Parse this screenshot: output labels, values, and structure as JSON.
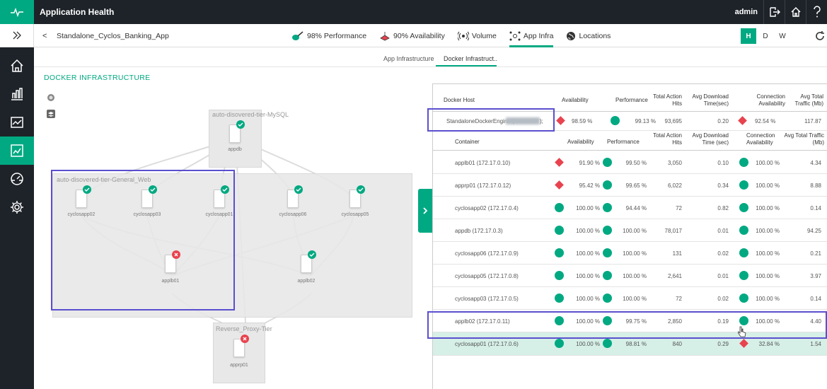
{
  "header": {
    "title": "Application Health",
    "user": "admin"
  },
  "toolbar": {
    "back": "<",
    "app_name": "Standalone_Cyclos_Banking_App",
    "tabs": [
      {
        "label": "98% Performance",
        "icon": "performance-icon"
      },
      {
        "label": "90% Availability",
        "icon": "availability-icon"
      },
      {
        "label": "Volume",
        "icon": "volume-icon"
      },
      {
        "label": "App Infra",
        "icon": "app-infra-icon",
        "active": true
      },
      {
        "label": "Locations",
        "icon": "globe-icon"
      }
    ],
    "time_buttons": [
      "H",
      "D",
      "W"
    ]
  },
  "subtabs": [
    "App Infrastructure",
    "Docker Infrastruct.."
  ],
  "section_title": "DOCKER INFRASTRUCTURE",
  "topology": {
    "tiers": [
      {
        "label": "auto-disovered-tier-MySQL"
      },
      {
        "label": "auto-disovered-tier-General_Web"
      },
      {
        "label": "Reverse_Proxy-Tier"
      }
    ],
    "nodes": [
      {
        "label": "appdb",
        "status": "ok"
      },
      {
        "label": "cyclosapp02",
        "status": "ok"
      },
      {
        "label": "cyclosapp03",
        "status": "ok"
      },
      {
        "label": "cyclosapp01",
        "status": "ok"
      },
      {
        "label": "cyclosapp06",
        "status": "ok"
      },
      {
        "label": "cyclosapp05",
        "status": "ok"
      },
      {
        "label": "applb01",
        "status": "bad"
      },
      {
        "label": "applb02",
        "status": "ok"
      },
      {
        "label": "apprp01",
        "status": "bad"
      }
    ]
  },
  "host_table": {
    "headers": [
      "Docker Host",
      "Availability",
      "Performance",
      "Total Action Hits",
      "Avg Download Time(sec)",
      "Connection Availability",
      "Avg Total Traffic (Mb)"
    ],
    "row": {
      "host": "StandaloneDockerEngine (",
      "availability": "98.59 %",
      "performance": "99.13 %",
      "hits": "93,695",
      "download": "0.20",
      "connection": "92.54 %",
      "traffic": "117.87"
    }
  },
  "container_table": {
    "headers": [
      "Container",
      "Availability",
      "Performance",
      "Total Action Hits",
      "Avg Download Time (sec)",
      "Connection Availability",
      "Avg Total Traffic (Mb)"
    ],
    "rows": [
      {
        "name": "applb01 (172.17.0.10)",
        "avail": "91.90 %",
        "avail_status": "bad",
        "perf": "99.50 %",
        "hits": "3,050",
        "dl": "0.10",
        "conn": "100.00 %",
        "conn_status": "ok",
        "traffic": "4.34"
      },
      {
        "name": "apprp01 (172.17.0.12)",
        "avail": "95.42 %",
        "avail_status": "bad",
        "perf": "99.65 %",
        "hits": "6,022",
        "dl": "0.34",
        "conn": "100.00 %",
        "conn_status": "ok",
        "traffic": "8.88"
      },
      {
        "name": "cyclosapp02 (172.17.0.4)",
        "avail": "100.00 %",
        "avail_status": "ok",
        "perf": "94.44 %",
        "hits": "72",
        "dl": "0.82",
        "conn": "100.00 %",
        "conn_status": "ok",
        "traffic": "0.14"
      },
      {
        "name": "appdb (172.17.0.3)",
        "avail": "100.00 %",
        "avail_status": "ok",
        "perf": "100.00 %",
        "hits": "78,017",
        "dl": "0.01",
        "conn": "100.00 %",
        "conn_status": "ok",
        "traffic": "94.25"
      },
      {
        "name": "cyclosapp06 (172.17.0.9)",
        "avail": "100.00 %",
        "avail_status": "ok",
        "perf": "100.00 %",
        "hits": "131",
        "dl": "0.02",
        "conn": "100.00 %",
        "conn_status": "ok",
        "traffic": "0.21"
      },
      {
        "name": "cyclosapp05 (172.17.0.8)",
        "avail": "100.00 %",
        "avail_status": "ok",
        "perf": "100.00 %",
        "hits": "2,641",
        "dl": "0.01",
        "conn": "100.00 %",
        "conn_status": "ok",
        "traffic": "3.97"
      },
      {
        "name": "cyclosapp03 (172.17.0.5)",
        "avail": "100.00 %",
        "avail_status": "ok",
        "perf": "100.00 %",
        "hits": "72",
        "dl": "0.02",
        "conn": "100.00 %",
        "conn_status": "ok",
        "traffic": "0.14"
      },
      {
        "name": "applb02 (172.17.0.11)",
        "avail": "100.00 %",
        "avail_status": "ok",
        "perf": "99.75 %",
        "hits": "2,850",
        "dl": "0.19",
        "conn": "100.00 %",
        "conn_status": "ok",
        "traffic": "4.40"
      },
      {
        "name": "cyclosapp01 (172.17.0.6)",
        "avail": "100.00 %",
        "avail_status": "ok",
        "perf": "98.81 %",
        "hits": "840",
        "dl": "0.29",
        "conn": "32.84 %",
        "conn_status": "bad",
        "traffic": "1.54"
      }
    ]
  },
  "colors": {
    "accent": "#01a982",
    "dark": "#1e2329",
    "error": "#e8434e",
    "highlight": "#5a4fcf"
  }
}
